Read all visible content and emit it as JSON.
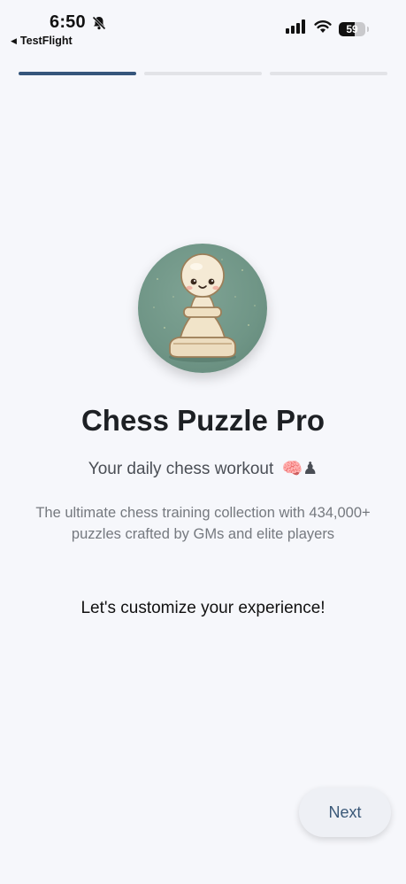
{
  "status_bar": {
    "time": "6:50",
    "back_app_label": "TestFlight",
    "battery_percent": "59",
    "icons": [
      "bell-slash-icon",
      "cellular-signal-icon",
      "wifi-icon",
      "battery-icon"
    ]
  },
  "progress": {
    "total_steps": 3,
    "current_step": 1,
    "active_color": "#36567c",
    "inactive_color": "#e2e3e7"
  },
  "onboarding": {
    "logo_icon": "pawn-mascot-icon",
    "title": "Chess Puzzle Pro",
    "subtitle": "Your daily chess workout",
    "subtitle_emoji": "🧠♟",
    "description": "The ultimate chess training collection with 434,000+ puzzles crafted by GMs and elite players",
    "cta_text": "Let's customize your experience!"
  },
  "buttons": {
    "next_label": "Next"
  },
  "colors": {
    "background": "#f6f7fb",
    "logo_background": "#6f9586",
    "next_text": "#3a5878"
  }
}
